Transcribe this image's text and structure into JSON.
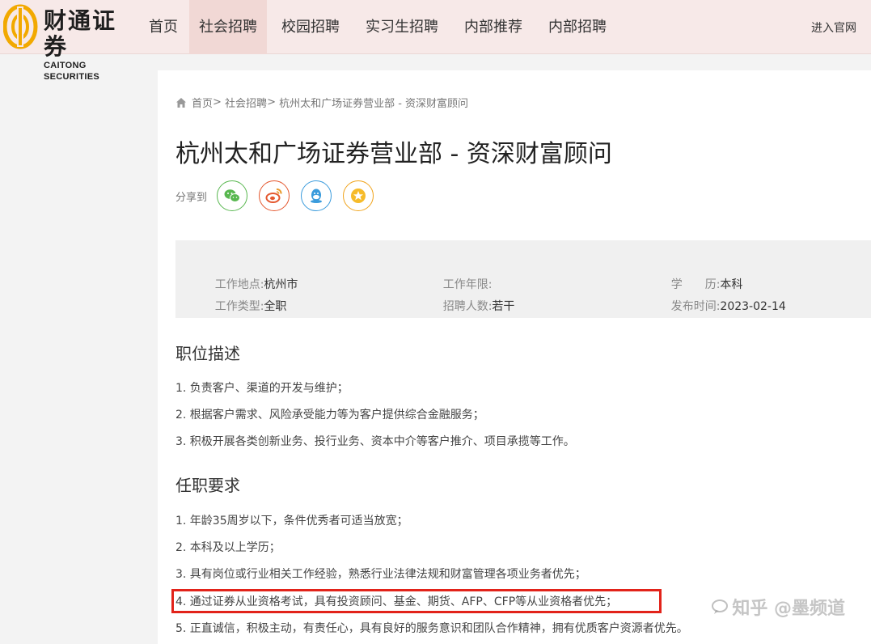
{
  "brand": {
    "name_cn": "财通证券",
    "name_en": "CAITONG SECURITIES",
    "colors": {
      "gold": "#f2a900",
      "nav_bg": "#f7e9e8",
      "active_bg": "#f1d8d5",
      "highlight": "#e2231a"
    }
  },
  "nav": {
    "items": [
      {
        "label": "首页"
      },
      {
        "label": "社会招聘"
      },
      {
        "label": "校园招聘"
      },
      {
        "label": "实习生招聘"
      },
      {
        "label": "内部推荐"
      },
      {
        "label": "内部招聘"
      }
    ],
    "active_index": 1,
    "official_link": "进入官网"
  },
  "breadcrumb": {
    "icon": "home-icon",
    "home": "首页",
    "sep1": "> ",
    "category": "社会招聘",
    "sep2": "> ",
    "current": "杭州太和广场证券营业部 - 资深财富顾问"
  },
  "job": {
    "title": "杭州太和广场证券营业部 - 资深财富顾问",
    "share_label": "分享到",
    "share_icons": [
      "wechat-icon",
      "weibo-icon",
      "qq-icon",
      "favorite-star-icon"
    ],
    "info": {
      "location_label": "工作地点:",
      "location_value": "杭州市",
      "experience_label": "工作年限:",
      "experience_value": "",
      "education_label": "学　　历:",
      "education_value": "本科",
      "type_label": "工作类型:",
      "type_value": "全职",
      "headcount_label": "招聘人数:",
      "headcount_value": "若干",
      "date_label": "发布时间:",
      "date_value": "2023-02-14"
    },
    "description_title": "职位描述",
    "description": [
      "1. 负责客户、渠道的开发与维护；",
      "2. 根据客户需求、风险承受能力等为客户提供综合金融服务；",
      "3. 积极开展各类创新业务、投行业务、资本中介等客户推介、项目承揽等工作。"
    ],
    "requirements_title": "任职要求",
    "requirements": [
      "1. 年龄35周岁以下，条件优秀者可适当放宽；",
      "2. 本科及以上学历；",
      "3. 具有岗位或行业相关工作经验，熟悉行业法律法规和财富管理各项业务者优先；",
      "4. 通过证券从业资格考试，具有投资顾问、基金、期货、AFP、CFP等从业资格者优先；",
      "5. 正直诚信，积极主动，有责任心，具有良好的服务意识和团队合作精神，拥有优质客户资源者优先。"
    ]
  },
  "watermark": {
    "text": "知乎 @墨频道"
  }
}
